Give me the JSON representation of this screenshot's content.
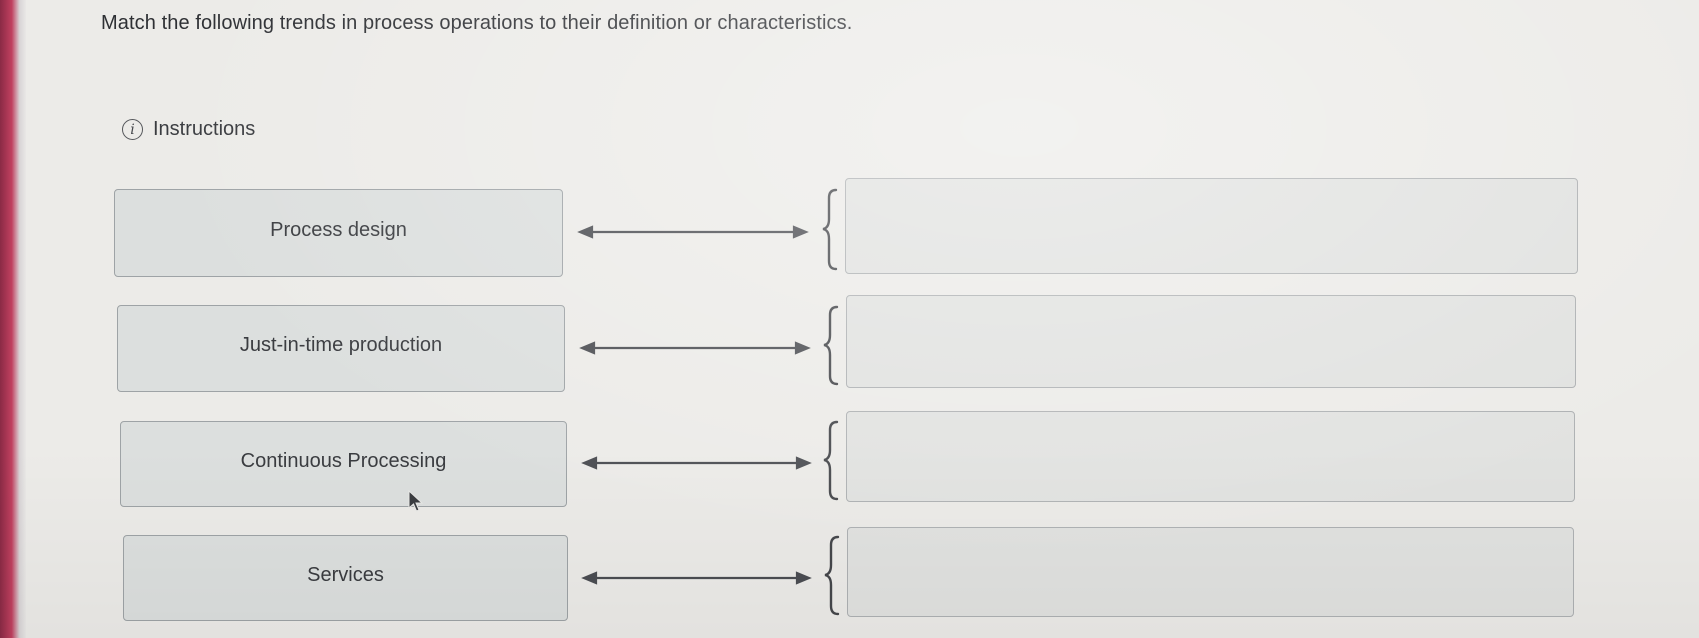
{
  "question": "Match the following trends in process operations to their definition or characteristics.",
  "instructions_label": "Instructions",
  "terms": [
    {
      "label": "Process design"
    },
    {
      "label": "Just-in-time production"
    },
    {
      "label": "Continuous Processing"
    },
    {
      "label": "Services"
    }
  ],
  "targets": [
    {
      "value": ""
    },
    {
      "value": ""
    },
    {
      "value": ""
    },
    {
      "value": ""
    }
  ],
  "colors": {
    "accent_edge": "#c0405f",
    "term_bg": "#dcdfde",
    "target_bg": "#e1e2e0"
  },
  "icons": {
    "info": "info-icon",
    "arrow": "double-arrow-icon",
    "bracket": "brace-icon",
    "pointer": "mouse-cursor-icon"
  }
}
